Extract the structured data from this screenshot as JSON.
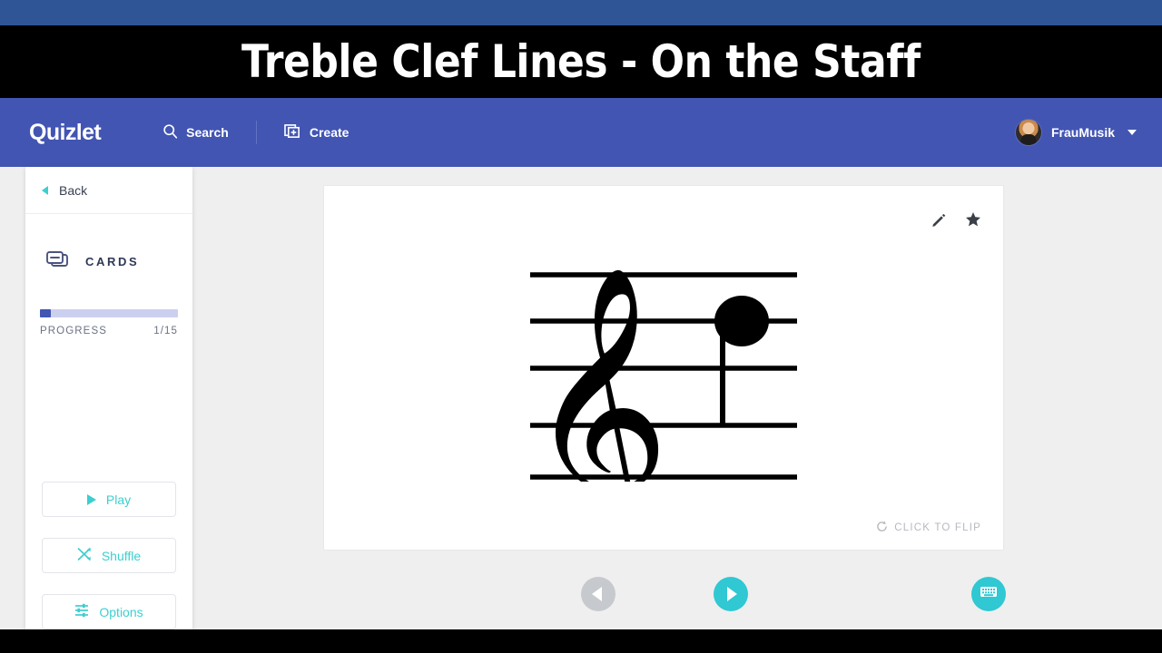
{
  "banner": {
    "title": "Treble Clef Lines - On the Staff"
  },
  "navbar": {
    "logo": "Quizlet",
    "search_label": "Search",
    "search_icon": "search-icon",
    "create_label": "Create",
    "create_icon": "create-card-icon",
    "username": "FrauMusik",
    "avatar_icon": "user-avatar",
    "caret_icon": "chevron-down-icon"
  },
  "sidebar": {
    "back_label": "Back",
    "back_icon": "chevron-left-icon",
    "section_label": "CARDS",
    "section_icon": "cards-icon",
    "progress": {
      "label": "PROGRESS",
      "value": "1/15",
      "percent": 8,
      "fill_color": "#4255b2",
      "track_color": "#ccd0ef"
    },
    "buttons": [
      {
        "label": "Play",
        "icon": "play-icon"
      },
      {
        "label": "Shuffle",
        "icon": "shuffle-icon"
      },
      {
        "label": "Options",
        "icon": "sliders-icon"
      }
    ]
  },
  "card": {
    "edit_icon": "pencil-icon",
    "star_icon": "star-icon",
    "flip_label": "CLICK TO FLIP",
    "flip_icon": "rotate-icon",
    "content_type": "music-notation",
    "notation": {
      "clef": "treble",
      "staff_lines": 5,
      "note": {
        "position": "line-4-from-bottom",
        "head": "filled",
        "stem": "down"
      }
    }
  },
  "controls": {
    "prev_label": "previous-card",
    "prev_icon": "arrow-left-icon",
    "prev_disabled": true,
    "next_label": "next-card",
    "next_icon": "arrow-right-icon",
    "keyboard_label": "keyboard-shortcuts",
    "keyboard_icon": "keyboard-icon"
  },
  "colors": {
    "brand_blue": "#4255b2",
    "teal": "#2fc8d3",
    "top_strip": "#2f5597",
    "page_bg": "#efefef"
  }
}
